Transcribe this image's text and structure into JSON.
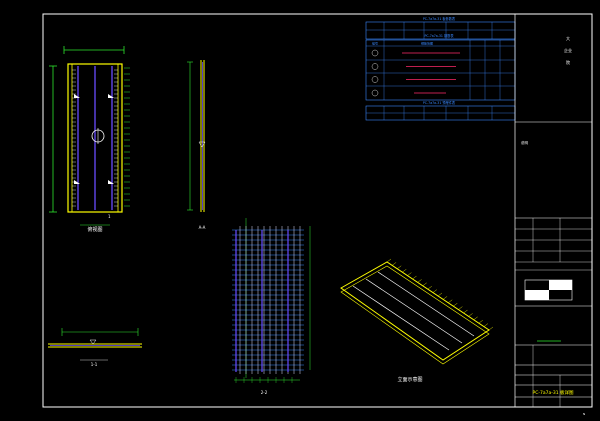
{
  "drawing": {
    "plan_view_label": "俯视图",
    "section_a_label": "A-A",
    "section_b_label": "1-1",
    "section_c_label": "2-2",
    "rebar_view_label": "",
    "iso_view_label": "立面示意图",
    "plan_tick_label": "1"
  },
  "tables": {
    "top": {
      "title": "PC-7a7a-31 板参数表",
      "headers": [
        "",
        "",
        "",
        "",
        "",
        "",
        ""
      ],
      "row": [
        "",
        "",
        "",
        "",
        "",
        "",
        ""
      ]
    },
    "middle": {
      "title": "PC-7a7a-31 钢筋表",
      "headers": [
        "编号",
        "钢筋简图",
        "",
        "",
        "",
        ""
      ],
      "rows": [
        [
          "",
          "",
          "",
          "",
          "",
          ""
        ],
        [
          "",
          "",
          "",
          "",
          "",
          ""
        ],
        [
          "",
          "",
          "",
          "",
          "",
          ""
        ],
        [
          "",
          "",
          "",
          "",
          "",
          ""
        ]
      ]
    },
    "bottom": {
      "title": "PC-7a7a-31 预埋件表",
      "headers": [
        "",
        "",
        "",
        "",
        "",
        "",
        ""
      ],
      "row": [
        "",
        "",
        "",
        "",
        "",
        "",
        ""
      ]
    }
  },
  "title_block": {
    "vertical_text_1": "大",
    "vertical_text_2": "企业",
    "vertical_text_3": "院",
    "note_label": "说明",
    "design_label": "",
    "sheet_title": "PC-7a7a-31 板详图",
    "sheet_no": "",
    "corner_mark": "N"
  }
}
